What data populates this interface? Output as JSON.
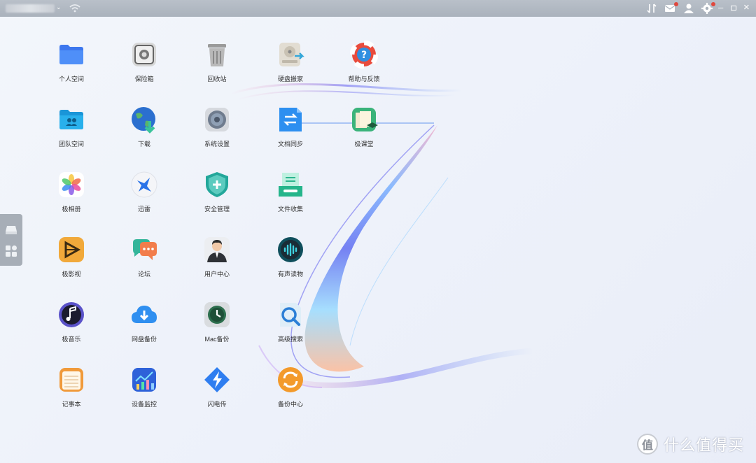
{
  "topbar": {
    "icons": [
      "transfer-icon",
      "mail-icon",
      "user-icon",
      "settings-icon",
      "minimize-icon",
      "maximize-icon",
      "close-icon"
    ],
    "minimize": "–",
    "close": "×"
  },
  "sidebar": {
    "icons": [
      "drive-icon",
      "apps-grid-icon"
    ]
  },
  "apps": [
    {
      "label": "个人空间",
      "icon": "folder-icon"
    },
    {
      "label": "保险箱",
      "icon": "safe-icon"
    },
    {
      "label": "回收站",
      "icon": "trash-icon"
    },
    {
      "label": "硬盘搬家",
      "icon": "disk-move-icon"
    },
    {
      "label": "帮助与反馈",
      "icon": "lifebuoy-icon"
    },
    {
      "label": "团队空间",
      "icon": "team-folder-icon"
    },
    {
      "label": "下载",
      "icon": "globe-download-icon"
    },
    {
      "label": "系统设置",
      "icon": "system-settings-icon"
    },
    {
      "label": "文档同步",
      "icon": "doc-sync-icon"
    },
    {
      "label": "极课堂",
      "icon": "classroom-icon"
    },
    {
      "label": "极相册",
      "icon": "photos-icon"
    },
    {
      "label": "迅雷",
      "icon": "thunder-bird-icon"
    },
    {
      "label": "安全管理",
      "icon": "shield-icon"
    },
    {
      "label": "文件收集",
      "icon": "file-collect-icon"
    },
    {
      "label": "极影视",
      "icon": "video-icon"
    },
    {
      "label": "论坛",
      "icon": "forum-icon"
    },
    {
      "label": "用户中心",
      "icon": "user-center-icon"
    },
    {
      "label": "有声读物",
      "icon": "audiobook-icon"
    },
    {
      "label": "极音乐",
      "icon": "music-icon"
    },
    {
      "label": "网盘备份",
      "icon": "cloud-backup-icon"
    },
    {
      "label": "Mac备份",
      "icon": "mac-backup-icon"
    },
    {
      "label": "高级搜索",
      "icon": "search-icon"
    },
    {
      "label": "记事本",
      "icon": "notepad-icon"
    },
    {
      "label": "设备监控",
      "icon": "monitor-chart-icon"
    },
    {
      "label": "闪电传",
      "icon": "lightning-icon"
    },
    {
      "label": "备份中心",
      "icon": "backup-center-icon"
    }
  ],
  "watermark": {
    "logo": "值",
    "text": "什么值得买"
  },
  "colors": {
    "topbar": "#aab2bc",
    "accent_blue": "#3a7df0",
    "alert_red": "#e0483e"
  }
}
